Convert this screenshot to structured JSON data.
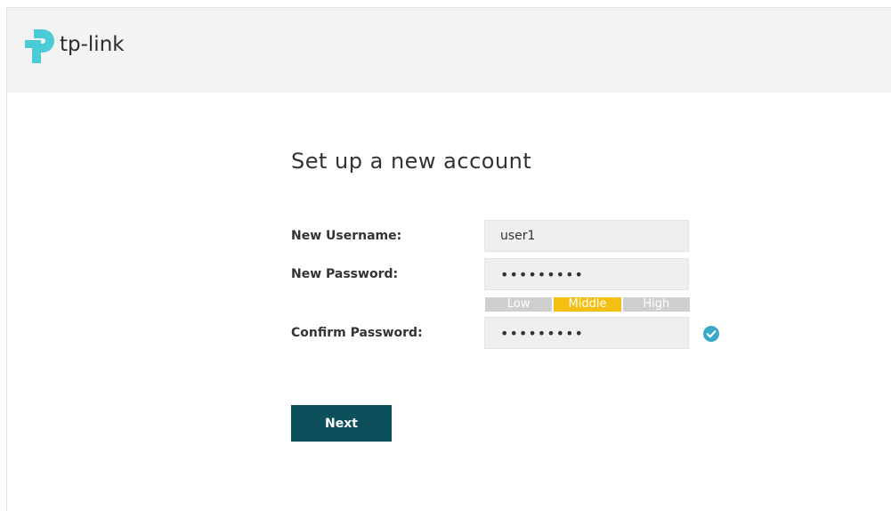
{
  "brand": {
    "name": "tp-link",
    "logo_color": "#4acbd6"
  },
  "page": {
    "title": "Set up a new account"
  },
  "form": {
    "username_label": "New Username:",
    "username_value": "user1",
    "password_label": "New Password:",
    "password_value": "•••••••••",
    "confirm_label": "Confirm Password:",
    "confirm_value": "•••••••••",
    "strength": {
      "levels": [
        "Low",
        "Middle",
        "High"
      ],
      "active": "Middle",
      "active_color": "#f5be13",
      "inactive_color": "#cfcfcf"
    },
    "confirm_status_icon": "check-circle-icon",
    "confirm_status_color": "#3aa9c9"
  },
  "actions": {
    "next_label": "Next",
    "next_color": "#0e4f5c"
  }
}
